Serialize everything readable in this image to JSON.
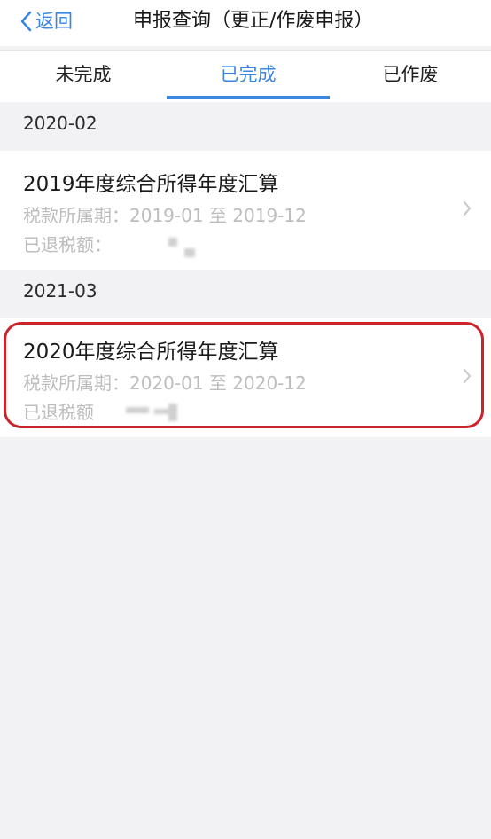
{
  "nav": {
    "back_label": "返回",
    "title": "申报查询（更正/作废申报）"
  },
  "tabs": [
    {
      "label": "未完成",
      "active": false
    },
    {
      "label": "已完成",
      "active": true
    },
    {
      "label": "已作废",
      "active": false
    }
  ],
  "sections": [
    {
      "date": "2020-02",
      "record": {
        "title": "2019年度综合所得年度汇算",
        "period_label": "税款所属期：",
        "period_value": "2019-01 至 2019-12",
        "refund_label": "已退税额："
      }
    },
    {
      "date": "2021-03",
      "record": {
        "title": "2020年度综合所得年度汇算",
        "period_label": "税款所属期：",
        "period_value": "2020-01 至 2020-12",
        "refund_label": "已退税额"
      }
    }
  ],
  "colors": {
    "accent": "#3b86e0",
    "highlight": "#cc2229",
    "muted_text": "#bdbdbd",
    "background": "#f2f2f4"
  }
}
